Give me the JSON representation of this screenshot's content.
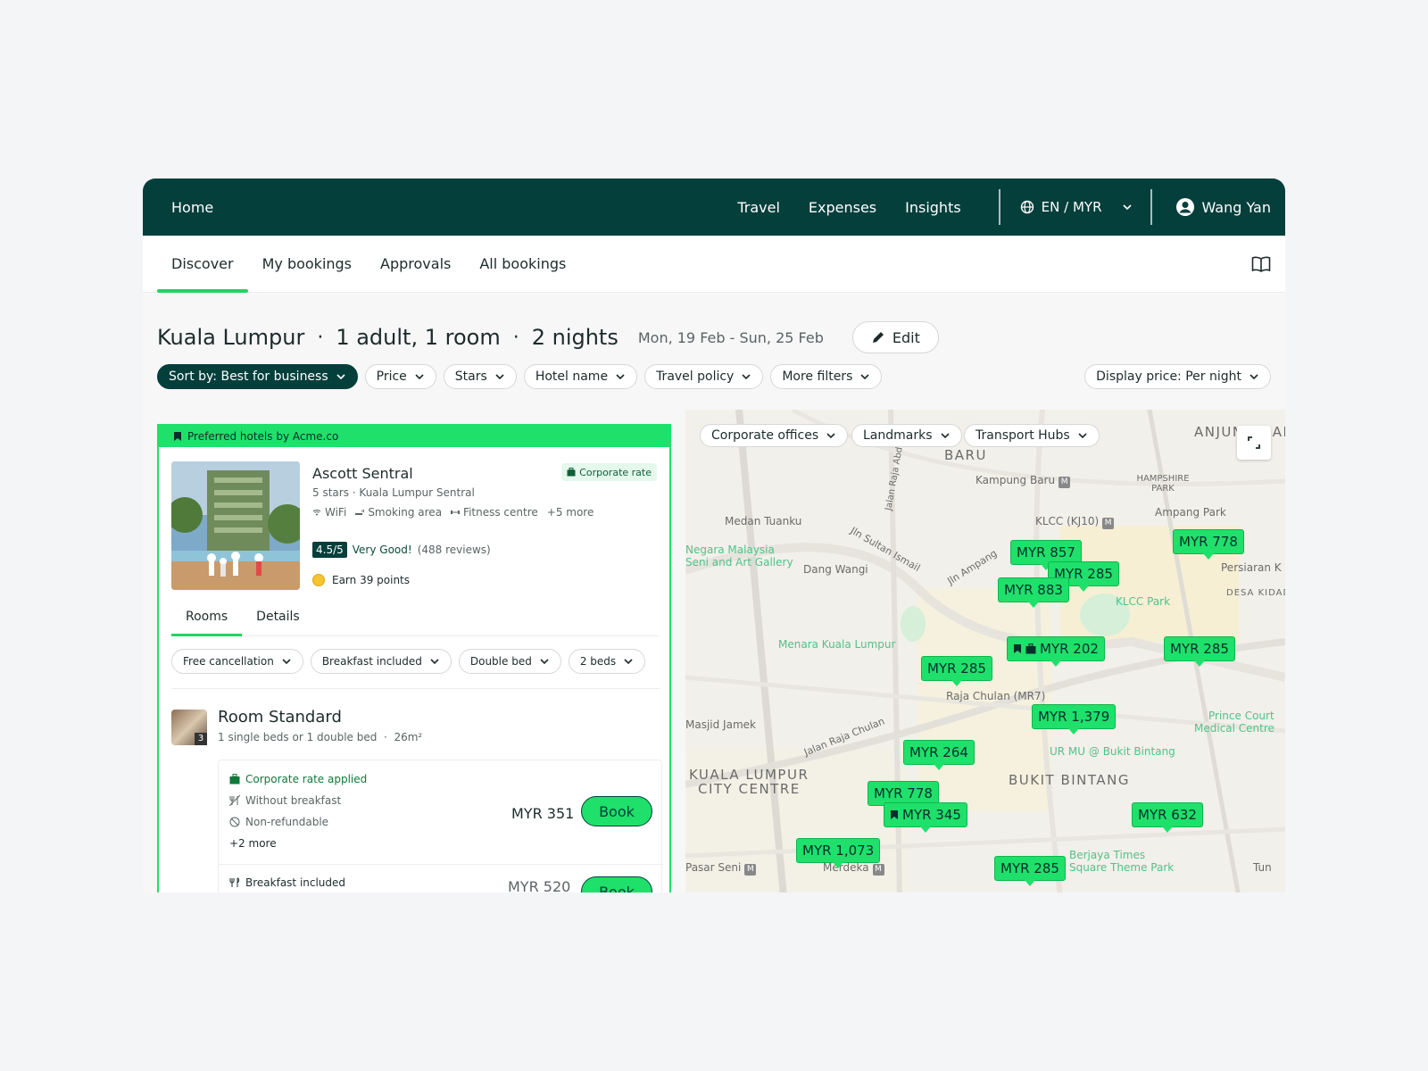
{
  "topnav": {
    "home": "Home",
    "links": [
      "Travel",
      "Expenses",
      "Insights"
    ],
    "locale": "EN / MYR",
    "user": "Wang Yan"
  },
  "subnav": {
    "tabs": [
      "Discover",
      "My bookings",
      "Approvals",
      "All bookings"
    ],
    "active_tab": "Discover"
  },
  "search": {
    "city": "Kuala Lumpur",
    "guests": "1 adult, 1 room",
    "nights": "2 nights",
    "dates": "Mon, 19 Feb - Sun, 25 Feb",
    "edit_label": "Edit"
  },
  "filters": {
    "sort": "Sort by: Best for business",
    "items": [
      "Price",
      "Stars",
      "Hotel name",
      "Travel policy",
      "More filters"
    ],
    "display_price": "Display price: Per night"
  },
  "hotel": {
    "preferred_label": "Preferred hotels by Acme.co",
    "name": "Ascott Sentral",
    "corporate_badge": "Corporate rate",
    "stars": "5 stars",
    "area": "Kuala Lumpur Sentral",
    "amenities": [
      "WiFi",
      "Smoking area",
      "Fitness centre",
      "+5 more"
    ],
    "score": "4.5/5",
    "rating_text": "Very Good!",
    "reviews": "(488 reviews)",
    "points": "Earn 39 points",
    "tabs": [
      "Rooms",
      "Details"
    ],
    "room_filters": [
      "Free cancellation",
      "Breakfast included",
      "Double bed",
      "2 beds"
    ],
    "room": {
      "name": "Room Standard",
      "photo_count": "3",
      "beds": "1 single beds or 1 double bed",
      "size": "26m²",
      "rates": [
        {
          "features": [
            "Corporate rate applied",
            "Without breakfast",
            "Non-refundable"
          ],
          "more": "+2 more",
          "price": "MYR 351",
          "book": "Book"
        },
        {
          "features": [
            "Breakfast included"
          ],
          "price": "MYR 520",
          "book": "Book"
        }
      ]
    }
  },
  "map": {
    "chips": [
      "Corporate offices",
      "Landmarks",
      "Transport Hubs"
    ],
    "pins": [
      "MYR 857",
      "MYR 285",
      "MYR 883",
      "MYR 778",
      "MYR 202",
      "MYR 285",
      "MYR 285",
      "MYR 1,379",
      "MYR 264",
      "MYR 778",
      "MYR 345",
      "MYR 632",
      "MYR 1,073",
      "MYR 285"
    ],
    "labels": [
      "ANJUNG DAMAI",
      "BARU",
      "Kampung Baru",
      "HAMPSHIRE PARK",
      "Medan Tuanku",
      "KLCC (KJ10)",
      "Ampang Park",
      "Persiaran K",
      "Negara Malaysia",
      "Seni and Art Gallery",
      "Dang Wangi",
      "KLCC Park",
      "DESA KIDADA",
      "Menara Kuala Lumpur",
      "Raja Chulan (MR7)",
      "Masjid Jamek",
      "KUALA LUMPUR",
      "CITY CENTRE",
      "BUKIT BINTANG",
      "UR MU @ Bukit Bintang",
      "Prince Court",
      "Medical Centre",
      "Berjaya Times",
      "Square Theme Park",
      "Pasar Seni",
      "Merdeka",
      "Tun",
      "Jalan Raja Chulan",
      "Jln Sultan Ismail",
      "Jln Ampang",
      "Jalan Raja Abdullah"
    ]
  },
  "colors": {
    "brand_dark": "#053f3c",
    "accent_green": "#1fe06a"
  }
}
